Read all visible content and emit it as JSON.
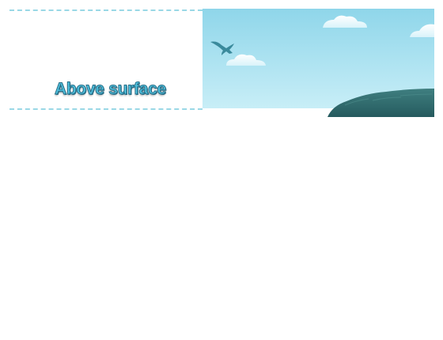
{
  "section": {
    "label": "Above surface"
  },
  "scene": {
    "sky_color_top": "#8fd6ea",
    "sky_color_bottom": "#c6edf6",
    "bird_color": "#3a8a9c",
    "rock_color": "#2f6c70",
    "icons": [
      "bird-icon",
      "cloud-icon",
      "rock-icon"
    ]
  }
}
